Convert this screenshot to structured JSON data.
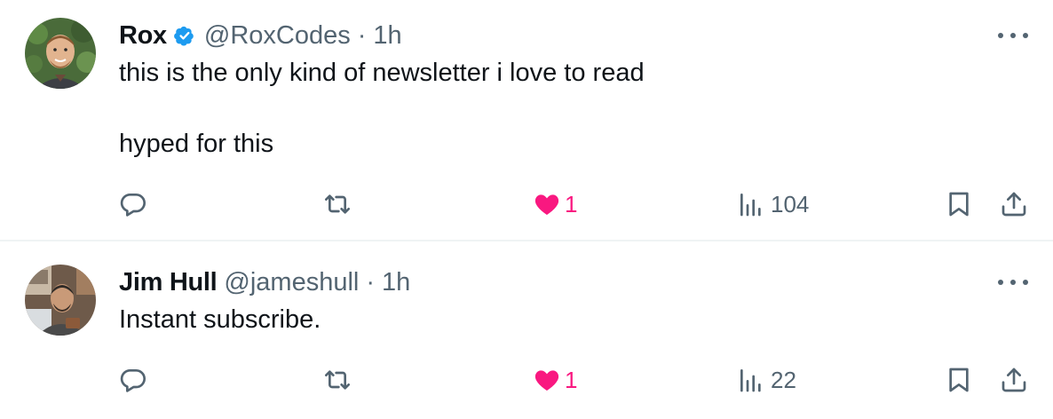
{
  "tweets": [
    {
      "name": "Rox",
      "handle": "@RoxCodes",
      "separator": "·",
      "time": "1h",
      "verified": true,
      "text": "this is the only kind of newsletter i love to read\n\nhyped for this",
      "likes": "1",
      "views": "104"
    },
    {
      "name": "Jim Hull",
      "handle": "@jameshull",
      "separator": "·",
      "time": "1h",
      "verified": false,
      "text": "Instant subscribe.",
      "likes": "1",
      "views": "22"
    }
  ],
  "icons": {
    "reply": "reply-icon",
    "retweet": "retweet-icon",
    "like": "heart-icon",
    "views": "views-icon",
    "bookmark": "bookmark-icon",
    "share": "share-icon",
    "more": "more-icon",
    "verified": "verified-badge-icon"
  },
  "colors": {
    "text": "#0f1419",
    "muted": "#536471",
    "like": "#f91880",
    "verified": "#1d9bf0",
    "divider": "#eff3f4"
  }
}
